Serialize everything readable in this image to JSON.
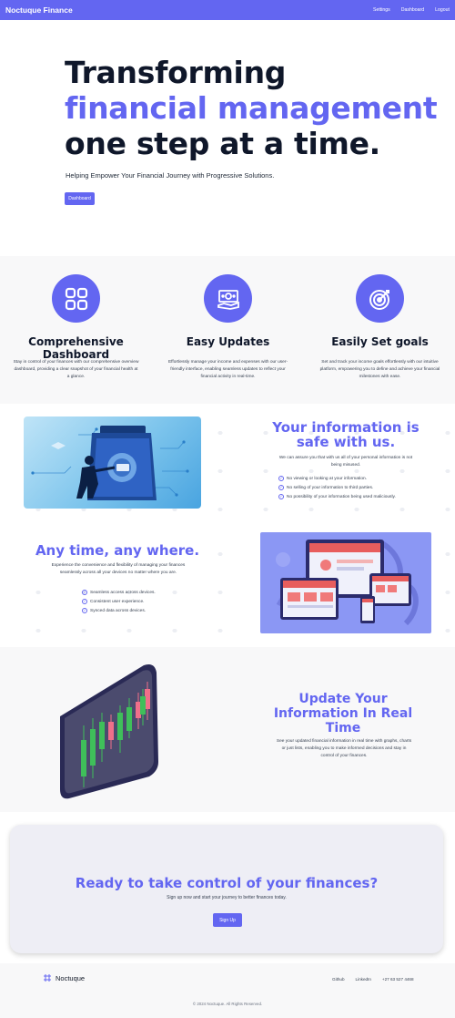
{
  "nav": {
    "brand": "Noctuque Finance",
    "links": [
      "Settings",
      "Dashboard",
      "Logout"
    ]
  },
  "hero": {
    "line1": "Transforming",
    "line2": "financial management",
    "line3": "one step at a time.",
    "subtitle": "Helping Empower Your Financial Journey with Progressive Solutions.",
    "button": "Dashboard"
  },
  "features": [
    {
      "icon": "dashboard-grid-icon",
      "title": "Comprehensive Dashboard",
      "text": "Stay in control of your finances with our comprehensive overview dashboard, providing a clear snapshot of your financial health at a glance."
    },
    {
      "icon": "money-hand-icon",
      "title": "Easy Updates",
      "text": "Effortlessly manage your income and expenses with our user-friendly interface, enabling seamless updates to reflect your financial activity in real-time."
    },
    {
      "icon": "target-icon",
      "title": "Easily Set goals",
      "text": "Set and track your income goals effortlessly with our intuitive platform, empowering you to define and achieve your financial milestones with ease."
    }
  ],
  "secure": {
    "title": "Your information is safe with us.",
    "description": "We can assure you that with us all of your personal information is not being misused.",
    "items": [
      "No viewing or looking at your information.",
      "No selling of your information to third parties.",
      "No possibility of your information being used maliciously."
    ]
  },
  "anytime": {
    "title": "Any time, any where.",
    "description": "Experience the convenience and flexibility of managing your finances seamlessly across all your devices no matter where you are.",
    "items": [
      "Seamless access across devices.",
      "Consistent user experience.",
      "Synced data across devices."
    ]
  },
  "realtime": {
    "title": "Update Your Information In Real Time",
    "description": "See your updated financial information in real time with graphs, charts or just lists, enabling you to make informed decisions and stay in control of your finances."
  },
  "cta": {
    "title": "Ready to take control of your finances?",
    "subtitle": "Sign up now and start your journey to better finances today.",
    "button": "Sign Up"
  },
  "footer": {
    "brand": "Noctuque",
    "links": [
      "Github",
      "LinkedIn",
      "+27 63 527 4468"
    ],
    "copyright": "© 2024 Noctuque. All Rights Reserved."
  },
  "colors": {
    "accent": "#6366f1",
    "dark": "#0f172a",
    "section_bg": "#f8f8f9"
  }
}
